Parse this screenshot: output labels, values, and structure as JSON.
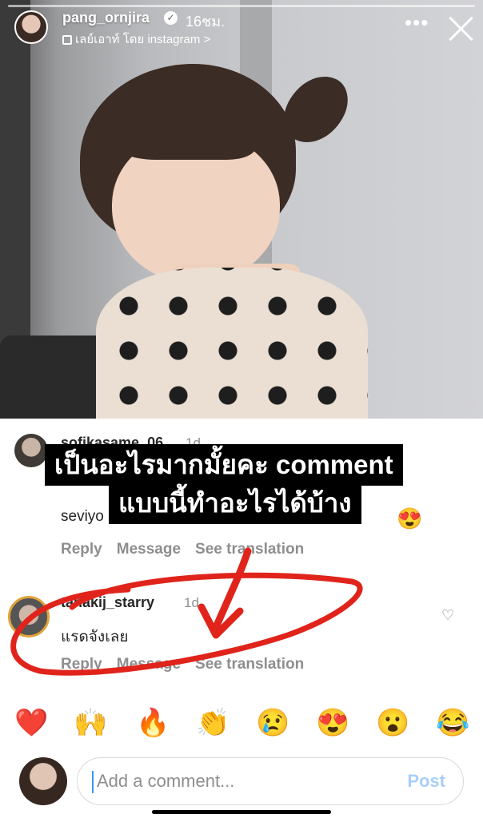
{
  "story": {
    "username": "pang_ornjira",
    "time": "16ชม.",
    "layout_text": "เลย์เอาท์ โดย instagram",
    "layout_chevron": ">",
    "more_label": "•••"
  },
  "overlay": {
    "line1": "เป็นอะไรมากมั้ยคะ comment",
    "line2": "แบบนี้ทำอะไรได้บ้าง"
  },
  "comments": [
    {
      "user": "sofikasame_06",
      "time": "1d",
      "text_partial": "seviyo",
      "actions": [
        "Reply",
        "Message",
        "See translation"
      ]
    },
    {
      "user": "tanakij_starry",
      "time": "1d",
      "text": "แรดจังเลย",
      "actions": [
        "Reply",
        "Message",
        "See translation"
      ]
    }
  ],
  "emoji_bar": [
    "❤️",
    "🙌",
    "🔥",
    "👏",
    "😢",
    "😍",
    "😮",
    "😂"
  ],
  "composer": {
    "placeholder": "Add a comment...",
    "post_label": "Post"
  },
  "colors": {
    "accent_post": "#a8cff7",
    "scribble": "#e0241b"
  }
}
